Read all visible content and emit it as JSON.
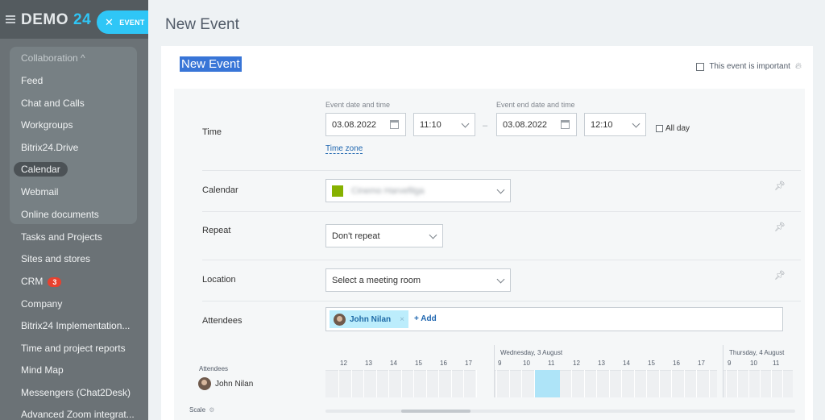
{
  "brand": {
    "name": "DEMO",
    "num": "24"
  },
  "event_chip": {
    "label": "EVENT"
  },
  "sidebar": {
    "group_header": "Collaboration ^",
    "items": [
      {
        "label": "Feed"
      },
      {
        "label": "Chat and Calls"
      },
      {
        "label": "Workgroups"
      },
      {
        "label": "Bitrix24.Drive"
      },
      {
        "label": "Calendar",
        "active": true
      },
      {
        "label": "Webmail"
      },
      {
        "label": "Online documents"
      },
      {
        "label": "Tasks and Projects"
      },
      {
        "label": "Sites and stores"
      },
      {
        "label": "CRM",
        "badge": "3"
      },
      {
        "label": "Company"
      },
      {
        "label": "Bitrix24 Implementation..."
      },
      {
        "label": "Time and project reports"
      },
      {
        "label": "Mind Map"
      },
      {
        "label": "Messengers (Chat2Desk)"
      },
      {
        "label": "Advanced Zoom integrat..."
      }
    ]
  },
  "page": {
    "title": "New Event"
  },
  "panel": {
    "title": "New Event",
    "important_label": "This event is important"
  },
  "form": {
    "time": {
      "label": "Time",
      "start_label": "Event date and time",
      "end_label": "Event end date and time",
      "start_date": "03.08.2022",
      "start_time": "11:10",
      "end_date": "03.08.2022",
      "end_time": "12:10",
      "dash": "–",
      "all_day": "All day",
      "timezone_link": "Time zone"
    },
    "calendar": {
      "label": "Calendar",
      "value": "Cinemo Harvefilga",
      "color": "#86b100"
    },
    "repeat": {
      "label": "Repeat",
      "value": "Don't repeat"
    },
    "location": {
      "label": "Location",
      "value": "Select a meeting room"
    },
    "attendees": {
      "label": "Attendees",
      "chip": "John Nilan",
      "chip_x": "×",
      "add": "+ Add"
    }
  },
  "planner": {
    "attendees_label": "Attendees",
    "person": "John Nilan",
    "day1": "Wednesday, 3 August",
    "day2": "Thursday, 4 August",
    "hours_a": [
      "12",
      "13",
      "14",
      "15",
      "16",
      "17"
    ],
    "hours_b": [
      "9",
      "10",
      "11",
      "12",
      "13",
      "14",
      "15",
      "16",
      "17"
    ],
    "hours_c": [
      "9",
      "10",
      "11"
    ],
    "scale": "Scale"
  }
}
